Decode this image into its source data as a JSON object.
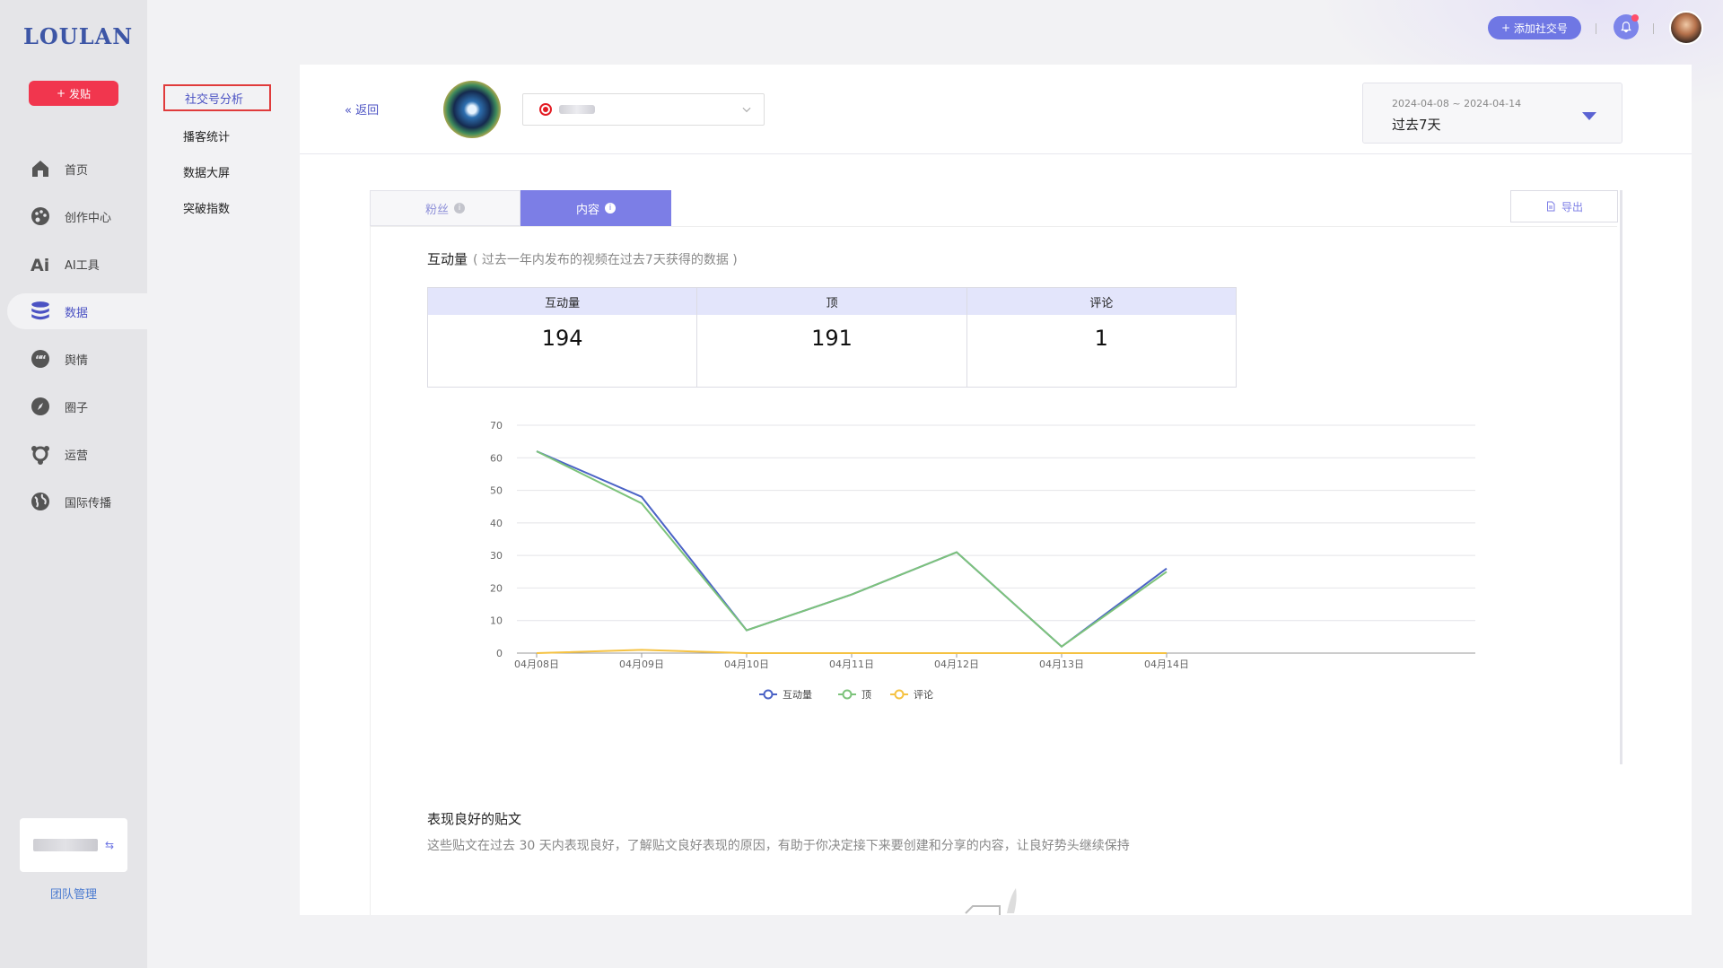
{
  "brand": {
    "logo": "LOULAN",
    "post_label": "发贴"
  },
  "nav": [
    {
      "label": "首页",
      "icon": "home-icon"
    },
    {
      "label": "创作中心",
      "icon": "palette-icon"
    },
    {
      "label": "AI工具",
      "icon": "ai-icon"
    },
    {
      "label": "数据",
      "icon": "database-icon",
      "active": true
    },
    {
      "label": "舆情",
      "icon": "quote-icon"
    },
    {
      "label": "圈子",
      "icon": "compass-icon"
    },
    {
      "label": "运营",
      "icon": "network-icon"
    },
    {
      "label": "国际传播",
      "icon": "globe-icon"
    }
  ],
  "team": {
    "link": "团队管理"
  },
  "submenu": [
    {
      "label": "社交号分析",
      "active": true
    },
    {
      "label": "播客统计"
    },
    {
      "label": "数据大屏"
    },
    {
      "label": "突破指数"
    }
  ],
  "header": {
    "add_social": "添加社交号"
  },
  "main": {
    "back": "返回",
    "date_range": "2024-04-08 ~ 2024-04-14",
    "date_label": "过去7天",
    "tabs": [
      {
        "label": "粉丝"
      },
      {
        "label": "内容",
        "active": true
      }
    ],
    "export": "导出",
    "section_title": "互动量",
    "section_note": "( 过去一年内发布的视频在过去7天获得的数据 )",
    "stats": [
      {
        "label": "互动量",
        "value": "194"
      },
      {
        "label": "顶",
        "value": "191"
      },
      {
        "label": "评论",
        "value": "1"
      }
    ],
    "good_title": "表现良好的贴文",
    "good_desc": "这些贴文在过去 30 天内表现良好，了解贴文良好表现的原因，有助于你决定接下来要创建和分享的内容，让良好势头继续保持"
  },
  "chart_data": {
    "type": "line",
    "categories": [
      "04月08日",
      "04月09日",
      "04月10日",
      "04月11日",
      "04月12日",
      "04月13日",
      "04月14日"
    ],
    "series": [
      {
        "name": "互动量",
        "values": [
          62,
          48,
          7,
          18,
          31,
          2,
          26
        ],
        "color": "#4b63c6"
      },
      {
        "name": "顶",
        "values": [
          62,
          46,
          7,
          18,
          31,
          2,
          25
        ],
        "color": "#7dc37b"
      },
      {
        "name": "评论",
        "values": [
          0,
          1,
          0,
          0,
          0,
          0,
          0
        ],
        "color": "#f5c242"
      }
    ],
    "ylim": [
      0,
      70
    ],
    "yticks": [
      0,
      10,
      20,
      30,
      40,
      50,
      60,
      70
    ],
    "grid": true,
    "legend": "bottom-center"
  }
}
